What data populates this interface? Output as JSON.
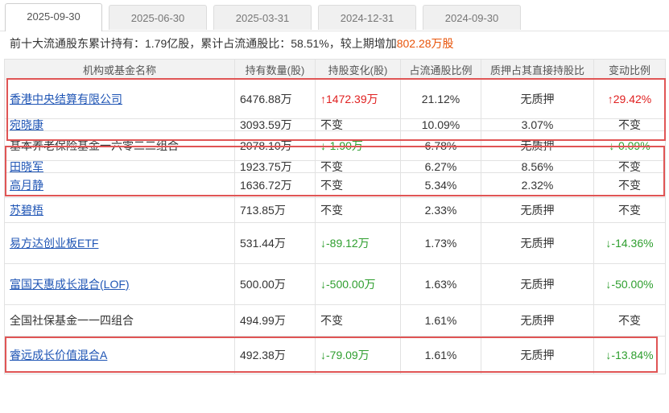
{
  "tabs": [
    "2025-09-30",
    "2025-06-30",
    "2025-03-31",
    "2024-12-31",
    "2024-09-30"
  ],
  "summary": {
    "prefix": "前十大流通股东累计持有：",
    "holding": "1.79亿股",
    "mid": "，累计占流通股比：",
    "ratio": "58.51%",
    "mid2": "，较上期增加",
    "increase": "802.28万股"
  },
  "columns": [
    "机构或基金名称",
    "持有数量(股)",
    "持股变化(股)",
    "占流通股比例",
    "质押占其直接持股比",
    "变动比例"
  ],
  "rows": [
    {
      "name": "香港中央结算有限公司",
      "link": true,
      "qty": "6476.88万",
      "chg": "1472.39万",
      "chg_dir": "up",
      "pct": "21.12%",
      "pledge": "无质押",
      "ratio": "29.42%",
      "ratio_dir": "up"
    },
    {
      "name": "宛晓康",
      "link": true,
      "qty": "3093.59万",
      "chg": "不变",
      "chg_dir": "none",
      "pct": "10.09%",
      "pledge": "3.07%",
      "ratio": "不变",
      "ratio_dir": "none"
    },
    {
      "name": "基本养老保险基金一六零二二组合",
      "link": false,
      "qty": "2078.10万",
      "chg": "-1.90万",
      "chg_dir": "down",
      "pct": "6.78%",
      "pledge": "无质押",
      "ratio": "-0.09%",
      "ratio_dir": "down"
    },
    {
      "name": "田晓军",
      "link": true,
      "qty": "1923.75万",
      "chg": "不变",
      "chg_dir": "none",
      "pct": "6.27%",
      "pledge": "8.56%",
      "ratio": "不变",
      "ratio_dir": "none"
    },
    {
      "name": "高月静",
      "link": true,
      "qty": "1636.72万",
      "chg": "不变",
      "chg_dir": "none",
      "pct": "5.34%",
      "pledge": "2.32%",
      "ratio": "不变",
      "ratio_dir": "none"
    },
    {
      "name": "苏碧梧",
      "link": true,
      "qty": "713.85万",
      "chg": "不变",
      "chg_dir": "none",
      "pct": "2.33%",
      "pledge": "无质押",
      "ratio": "不变",
      "ratio_dir": "none"
    },
    {
      "name": "易方达创业板ETF",
      "link": true,
      "qty": "531.44万",
      "chg": "-89.12万",
      "chg_dir": "down",
      "pct": "1.73%",
      "pledge": "无质押",
      "ratio": "-14.36%",
      "ratio_dir": "down"
    },
    {
      "name": "富国天惠成长混合(LOF)",
      "link": true,
      "qty": "500.00万",
      "chg": "-500.00万",
      "chg_dir": "down",
      "pct": "1.63%",
      "pledge": "无质押",
      "ratio": "-50.00%",
      "ratio_dir": "down"
    },
    {
      "name": "全国社保基金一一四组合",
      "link": false,
      "qty": "494.99万",
      "chg": "不变",
      "chg_dir": "none",
      "pct": "1.61%",
      "pledge": "无质押",
      "ratio": "不变",
      "ratio_dir": "none"
    },
    {
      "name": "睿远成长价值混合A",
      "link": true,
      "qty": "492.38万",
      "chg": "-79.09万",
      "chg_dir": "down",
      "pct": "1.61%",
      "pledge": "无质押",
      "ratio": "-13.84%",
      "ratio_dir": "down"
    }
  ],
  "colors": {
    "up": "#e02020",
    "down": "#2e9e2e",
    "highlight": "#e05555",
    "link": "#1f55b5"
  }
}
